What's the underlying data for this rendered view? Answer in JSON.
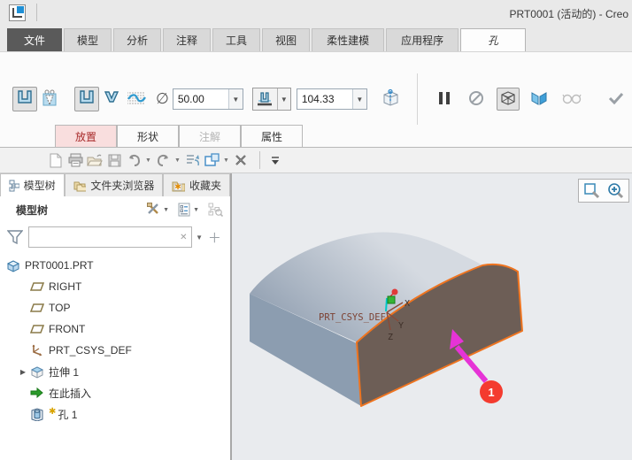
{
  "window": {
    "title": "PRT0001 (活动的) - Creo"
  },
  "ribbon": {
    "tabs": [
      {
        "label": "文件"
      },
      {
        "label": "模型"
      },
      {
        "label": "分析"
      },
      {
        "label": "注释"
      },
      {
        "label": "工具"
      },
      {
        "label": "视图"
      },
      {
        "label": "柔性建模"
      },
      {
        "label": "应用程序"
      },
      {
        "label": "孔"
      }
    ]
  },
  "dashboard": {
    "diameter_symbol": "∅",
    "diameter_value": "50.00",
    "depth_value": "104.33",
    "tabs": [
      {
        "label": "放置"
      },
      {
        "label": "形状"
      },
      {
        "label": "注解"
      },
      {
        "label": "属性"
      }
    ]
  },
  "model_tree": {
    "tabs": [
      {
        "label": "模型树"
      },
      {
        "label": "文件夹浏览器"
      },
      {
        "label": "收藏夹"
      }
    ],
    "header_label": "模型树",
    "filter_value": "",
    "items": [
      {
        "label": "PRT0001.PRT"
      },
      {
        "label": "RIGHT"
      },
      {
        "label": "TOP"
      },
      {
        "label": "FRONT"
      },
      {
        "label": "PRT_CSYS_DEF"
      },
      {
        "label": "拉伸 1"
      },
      {
        "label": "在此插入"
      },
      {
        "label": "孔 1",
        "badge": "✱"
      }
    ]
  },
  "viewport": {
    "csys_label": "PRT_CSYS_DEF",
    "axes": {
      "x": "X",
      "y": "Y",
      "z": "Z"
    },
    "callout": "1",
    "colors": {
      "background": "#e9ebee",
      "body_face": "#8c9db0",
      "selected_face": "#6d5e56",
      "highlight_edge": "#ee7420",
      "annotation_arrow": "#e633d6",
      "callout_badge": "#f43b2f"
    }
  }
}
